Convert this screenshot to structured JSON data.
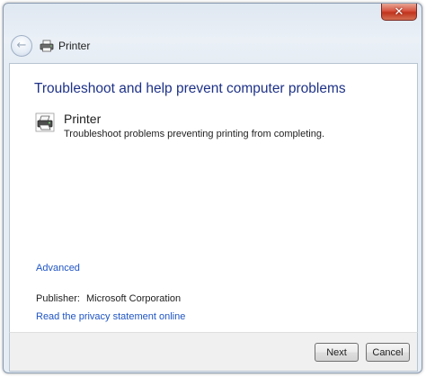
{
  "window": {
    "close_glyph": "✕"
  },
  "nav": {
    "back_glyph": "←",
    "title": "Printer"
  },
  "main": {
    "heading": "Troubleshoot and help prevent computer problems",
    "item": {
      "title": "Printer",
      "description": "Troubleshoot problems preventing printing from completing.",
      "icon": "printer-icon"
    },
    "advanced_label": "Advanced",
    "publisher_label": "Publisher:",
    "publisher_name": "Microsoft Corporation",
    "privacy_link": "Read the privacy statement online"
  },
  "footer": {
    "next_label": "Next",
    "cancel_label": "Cancel"
  },
  "colors": {
    "heading": "#1e3287",
    "link": "#1f55c4",
    "close_button": "#c1331d"
  }
}
